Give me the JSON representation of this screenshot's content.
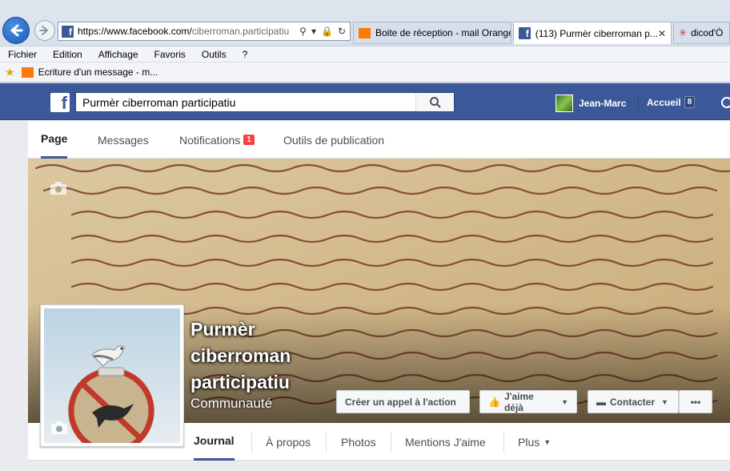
{
  "browser": {
    "url_prefix": "https://www.facebook.com/",
    "url_rest": "ciberroman.participatiu",
    "tabs": [
      {
        "label": "Boite de réception - mail Orange"
      },
      {
        "label": "(113) Purmèr ciberroman p..."
      },
      {
        "label": "dicod'Ò"
      }
    ],
    "menu": [
      "Fichier",
      "Edition",
      "Affichage",
      "Favoris",
      "Outils",
      "?"
    ],
    "favorite": "Ecriture d'un message - m..."
  },
  "fb": {
    "logo": "f",
    "search_value": "Purmèr ciberroman participatiu",
    "user_name": "Jean-Marc",
    "home_label": "Accueil",
    "home_count": "8"
  },
  "page_tabs": {
    "page": "Page",
    "messages": "Messages",
    "notifications": "Notifications",
    "notifications_count": "1",
    "tools": "Outils de publication"
  },
  "cover": {
    "title": "Purmèr ciberroman participatiu",
    "category": "Communauté",
    "cta_button": "Créer un appel à l'action",
    "like_button": "J'aime déjà",
    "contact_button": "Contacter",
    "more_button": "•••"
  },
  "lower_tabs": {
    "journal": "Journal",
    "about": "À propos",
    "photos": "Photos",
    "likes": "Mentions J'aime",
    "more": "Plus"
  },
  "colors": {
    "fb_blue": "#3b5998",
    "badge_red": "#fa3e3e",
    "parchment": "#d9c59a"
  }
}
